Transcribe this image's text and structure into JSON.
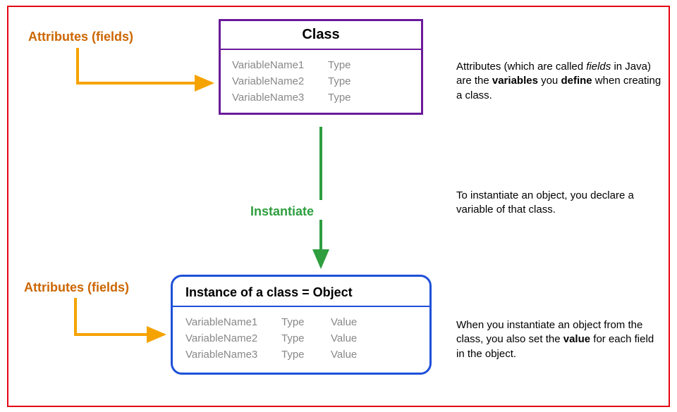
{
  "attrLabel1": "Attributes (fields)",
  "attrLabel2": "Attributes (fields)",
  "classBox": {
    "title": "Class",
    "rows": [
      {
        "name": "VariableName1",
        "type": "Type"
      },
      {
        "name": "VariableName2",
        "type": "Type"
      },
      {
        "name": "VariableName3",
        "type": "Type"
      }
    ]
  },
  "instantiate": "Instantiate",
  "objectBox": {
    "title": "Instance of a class = Object",
    "rows": [
      {
        "name": "VariableName1",
        "type": "Type",
        "value": "Value"
      },
      {
        "name": "VariableName2",
        "type": "Type",
        "value": "Value"
      },
      {
        "name": "VariableName3",
        "type": "Type",
        "value": "Value"
      }
    ]
  },
  "explain1": {
    "t1": "Attributes (which are called ",
    "fields": "fields",
    "t2": " in Java) are the ",
    "variables": "variables",
    "t3": " you ",
    "define": "define",
    "t4": " when creating a class."
  },
  "explain2": "To instantiate an object, you declare a variable of that class.",
  "explain3": {
    "t1": "When you instantiate an object from the class, you also set the ",
    "value": "value",
    "t2": " for each field in the object."
  }
}
